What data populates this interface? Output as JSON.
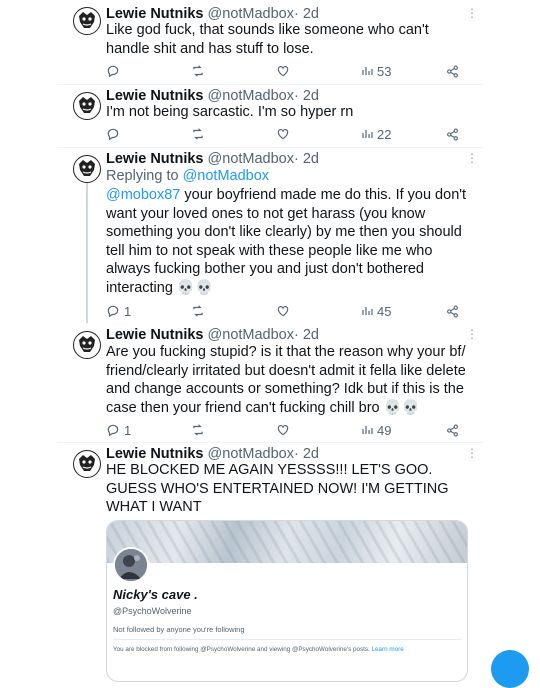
{
  "tweets": [
    {
      "name": "Lewie Nutniks",
      "handle": "@notMadbox",
      "time": "· 2d",
      "text": "Like god fuck, that sounds like someone who can't handle shit and has stuff to lose.",
      "replies": "",
      "retweets": "",
      "likes": "",
      "views": "53"
    },
    {
      "name": "Lewie Nutniks",
      "handle": "@notMadbox",
      "time": "· 2d",
      "text": "I'm not being sarcastic. I'm so hyper rn",
      "replies": "",
      "retweets": "",
      "likes": "",
      "views": "22"
    },
    {
      "name": "Lewie Nutniks",
      "handle": "@notMadbox",
      "time": "· 2d",
      "replying_label": "Replying to",
      "replying_to": "@notMadbox",
      "mention": "@mobox87",
      "text": " your boyfriend made me do this. If you don't want your loved ones to not get harass (you know something you don't like clearly) by me then you should tell him to not speak with these people like me who always fucking bother you and just don't bothered interacting 💀💀",
      "replies": "1",
      "retweets": "",
      "likes": "",
      "views": "45"
    },
    {
      "name": "Lewie Nutniks",
      "handle": "@notMadbox",
      "time": "· 2d",
      "text": "Are you fucking stupid? is it that the reason why your bf/ friend/clearly irritated but doesn't admit it fella like delete and change accounts or something? Idk but if this is the case then your friend can't fucking chill bro 💀💀",
      "replies": "1",
      "retweets": "",
      "likes": "",
      "views": "49"
    },
    {
      "name": "Lewie Nutniks",
      "handle": "@notMadbox",
      "time": "· 2d",
      "text": "HE BLOCKED ME AGAIN YESSSS!!! LET'S GOO. GUESS WHO'S ENTERTAINED NOW! I'M GETTING WHAT I WANT"
    }
  ],
  "card": {
    "name": "Nicky's cave .",
    "handle": "@PsychoWolverine",
    "follow_note": "Not followed by anyone you're following",
    "blocked_text": "You are blocked from following @PsychoWolverine and viewing @PsychoWolverine's posts.",
    "learn_more": "Learn more"
  },
  "icons": {
    "reply": "reply-icon",
    "retweet": "retweet-icon",
    "like": "heart-icon",
    "views": "views-icon",
    "share": "share-icon",
    "more": "more-icon"
  },
  "colors": {
    "accent": "#1d9bf0",
    "muted": "#536471",
    "text": "#0f1419"
  }
}
